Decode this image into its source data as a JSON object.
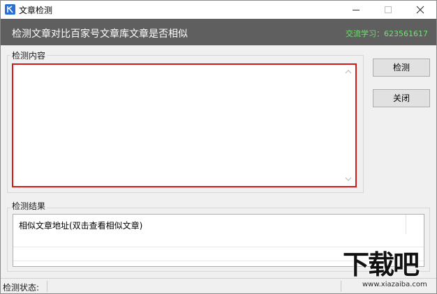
{
  "window": {
    "title": "文章检测",
    "icons": {
      "app": "app-icon",
      "minimize": "minimize-icon",
      "maximize": "maximize-icon",
      "close": "close-icon"
    }
  },
  "banner": {
    "title": "检测文章对比百家号文章库文章是否相似",
    "contact": "交流学习：623561617",
    "contact_color": "#6fe26f",
    "bg_color": "#5f5f5f"
  },
  "content_group": {
    "label": "检测内容",
    "textarea_value": "",
    "highlight_color": "#d21a1a"
  },
  "buttons": {
    "detect": "检测",
    "close": "关闭"
  },
  "result_group": {
    "label": "检测结果",
    "column_header": "相似文章地址(双击查看相似文章)"
  },
  "statusbar": {
    "label": "检测状态:",
    "value": ""
  },
  "watermark": {
    "brand": "下载吧",
    "url": "www.xiazaiba.com"
  }
}
